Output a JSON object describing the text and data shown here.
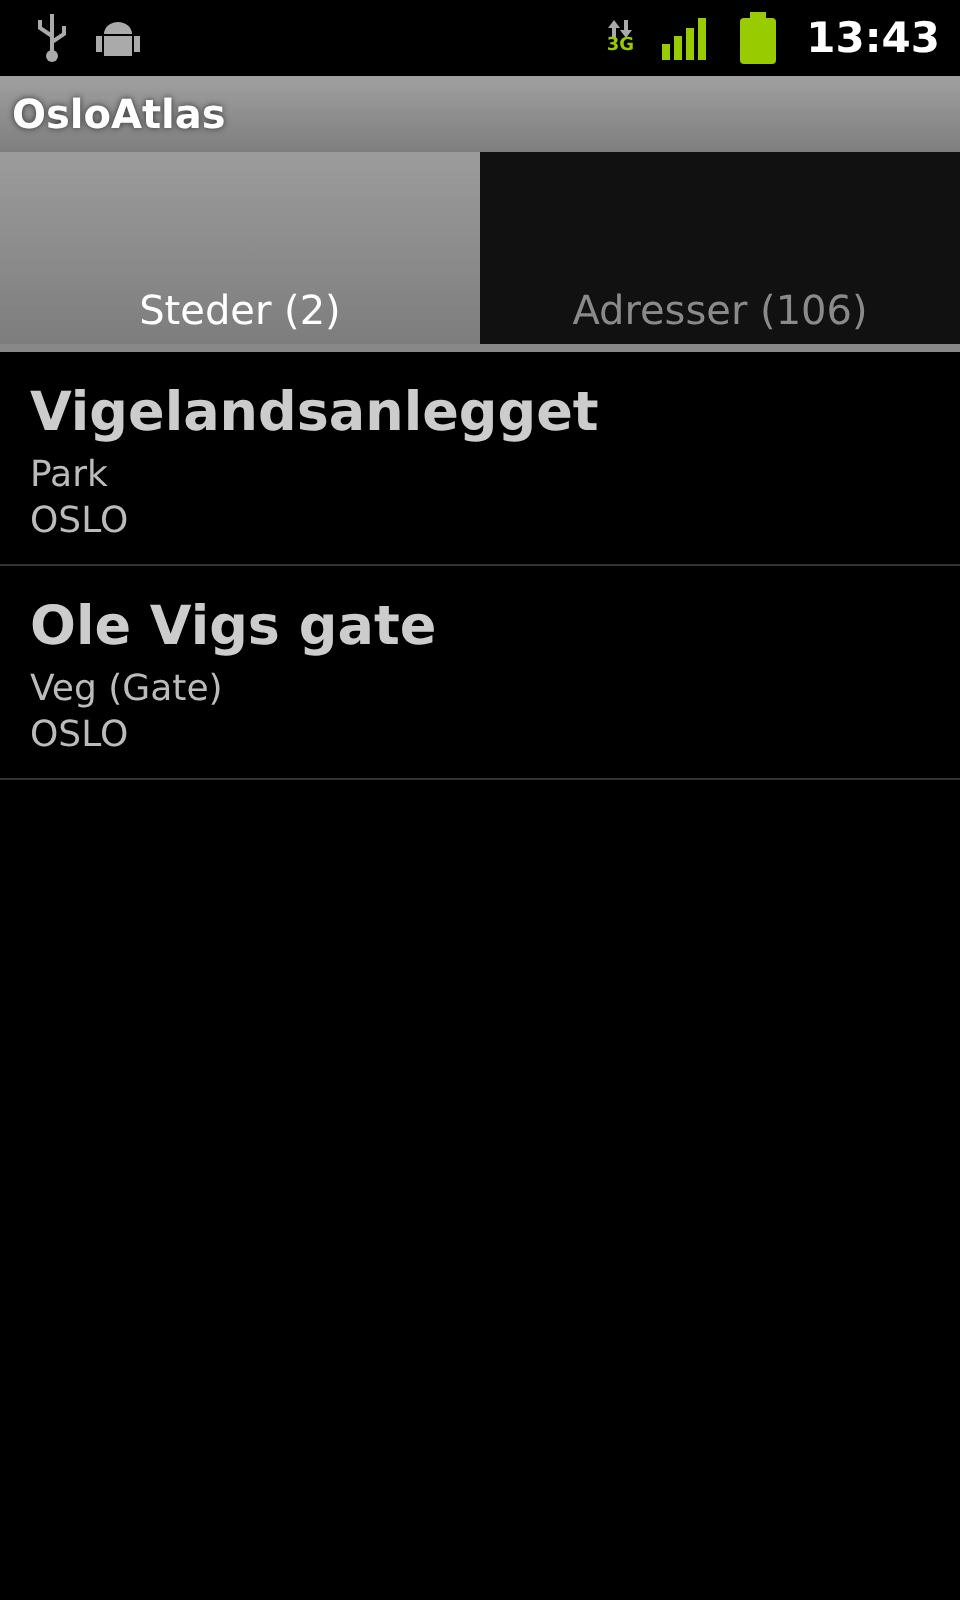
{
  "status_bar": {
    "network": "3G",
    "time": "13:43"
  },
  "window": {
    "title": "OsloAtlas"
  },
  "tabs": [
    {
      "label": "Steder (2)",
      "selected": true
    },
    {
      "label": "Adresser (106)",
      "selected": false
    }
  ],
  "results": [
    {
      "name": "Vigelandsanlegget",
      "type": "Park",
      "city": "OSLO"
    },
    {
      "name": "Ole Vigs gate",
      "type": "Veg (Gate)",
      "city": "OSLO"
    }
  ]
}
